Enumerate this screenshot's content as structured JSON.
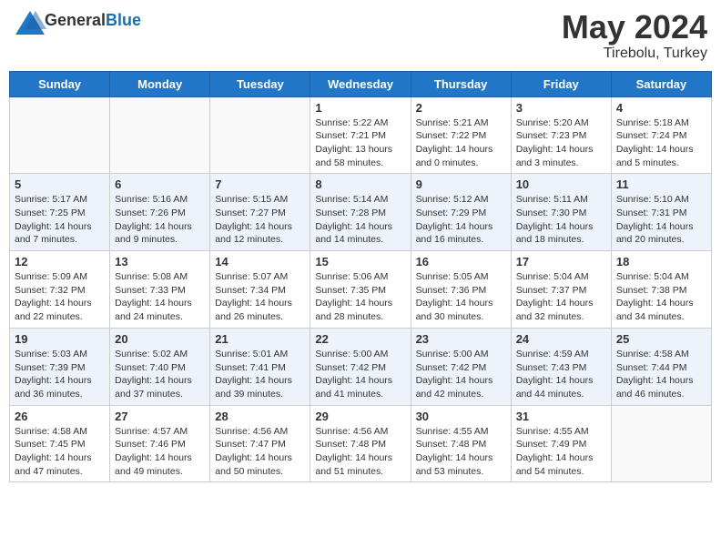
{
  "header": {
    "logo_general": "General",
    "logo_blue": "Blue",
    "title": "May 2024",
    "location": "Tirebolu, Turkey"
  },
  "weekdays": [
    "Sunday",
    "Monday",
    "Tuesday",
    "Wednesday",
    "Thursday",
    "Friday",
    "Saturday"
  ],
  "weeks": [
    [
      {
        "day": null
      },
      {
        "day": null
      },
      {
        "day": null
      },
      {
        "day": "1",
        "sunrise": "5:22 AM",
        "sunset": "7:21 PM",
        "daylight": "13 hours and 58 minutes."
      },
      {
        "day": "2",
        "sunrise": "5:21 AM",
        "sunset": "7:22 PM",
        "daylight": "14 hours and 0 minutes."
      },
      {
        "day": "3",
        "sunrise": "5:20 AM",
        "sunset": "7:23 PM",
        "daylight": "14 hours and 3 minutes."
      },
      {
        "day": "4",
        "sunrise": "5:18 AM",
        "sunset": "7:24 PM",
        "daylight": "14 hours and 5 minutes."
      }
    ],
    [
      {
        "day": "5",
        "sunrise": "5:17 AM",
        "sunset": "7:25 PM",
        "daylight": "14 hours and 7 minutes."
      },
      {
        "day": "6",
        "sunrise": "5:16 AM",
        "sunset": "7:26 PM",
        "daylight": "14 hours and 9 minutes."
      },
      {
        "day": "7",
        "sunrise": "5:15 AM",
        "sunset": "7:27 PM",
        "daylight": "14 hours and 12 minutes."
      },
      {
        "day": "8",
        "sunrise": "5:14 AM",
        "sunset": "7:28 PM",
        "daylight": "14 hours and 14 minutes."
      },
      {
        "day": "9",
        "sunrise": "5:12 AM",
        "sunset": "7:29 PM",
        "daylight": "14 hours and 16 minutes."
      },
      {
        "day": "10",
        "sunrise": "5:11 AM",
        "sunset": "7:30 PM",
        "daylight": "14 hours and 18 minutes."
      },
      {
        "day": "11",
        "sunrise": "5:10 AM",
        "sunset": "7:31 PM",
        "daylight": "14 hours and 20 minutes."
      }
    ],
    [
      {
        "day": "12",
        "sunrise": "5:09 AM",
        "sunset": "7:32 PM",
        "daylight": "14 hours and 22 minutes."
      },
      {
        "day": "13",
        "sunrise": "5:08 AM",
        "sunset": "7:33 PM",
        "daylight": "14 hours and 24 minutes."
      },
      {
        "day": "14",
        "sunrise": "5:07 AM",
        "sunset": "7:34 PM",
        "daylight": "14 hours and 26 minutes."
      },
      {
        "day": "15",
        "sunrise": "5:06 AM",
        "sunset": "7:35 PM",
        "daylight": "14 hours and 28 minutes."
      },
      {
        "day": "16",
        "sunrise": "5:05 AM",
        "sunset": "7:36 PM",
        "daylight": "14 hours and 30 minutes."
      },
      {
        "day": "17",
        "sunrise": "5:04 AM",
        "sunset": "7:37 PM",
        "daylight": "14 hours and 32 minutes."
      },
      {
        "day": "18",
        "sunrise": "5:04 AM",
        "sunset": "7:38 PM",
        "daylight": "14 hours and 34 minutes."
      }
    ],
    [
      {
        "day": "19",
        "sunrise": "5:03 AM",
        "sunset": "7:39 PM",
        "daylight": "14 hours and 36 minutes."
      },
      {
        "day": "20",
        "sunrise": "5:02 AM",
        "sunset": "7:40 PM",
        "daylight": "14 hours and 37 minutes."
      },
      {
        "day": "21",
        "sunrise": "5:01 AM",
        "sunset": "7:41 PM",
        "daylight": "14 hours and 39 minutes."
      },
      {
        "day": "22",
        "sunrise": "5:00 AM",
        "sunset": "7:42 PM",
        "daylight": "14 hours and 41 minutes."
      },
      {
        "day": "23",
        "sunrise": "5:00 AM",
        "sunset": "7:42 PM",
        "daylight": "14 hours and 42 minutes."
      },
      {
        "day": "24",
        "sunrise": "4:59 AM",
        "sunset": "7:43 PM",
        "daylight": "14 hours and 44 minutes."
      },
      {
        "day": "25",
        "sunrise": "4:58 AM",
        "sunset": "7:44 PM",
        "daylight": "14 hours and 46 minutes."
      }
    ],
    [
      {
        "day": "26",
        "sunrise": "4:58 AM",
        "sunset": "7:45 PM",
        "daylight": "14 hours and 47 minutes."
      },
      {
        "day": "27",
        "sunrise": "4:57 AM",
        "sunset": "7:46 PM",
        "daylight": "14 hours and 49 minutes."
      },
      {
        "day": "28",
        "sunrise": "4:56 AM",
        "sunset": "7:47 PM",
        "daylight": "14 hours and 50 minutes."
      },
      {
        "day": "29",
        "sunrise": "4:56 AM",
        "sunset": "7:48 PM",
        "daylight": "14 hours and 51 minutes."
      },
      {
        "day": "30",
        "sunrise": "4:55 AM",
        "sunset": "7:48 PM",
        "daylight": "14 hours and 53 minutes."
      },
      {
        "day": "31",
        "sunrise": "4:55 AM",
        "sunset": "7:49 PM",
        "daylight": "14 hours and 54 minutes."
      },
      {
        "day": null
      }
    ]
  ],
  "labels": {
    "sunrise": "Sunrise:",
    "sunset": "Sunset:",
    "daylight": "Daylight hours"
  }
}
